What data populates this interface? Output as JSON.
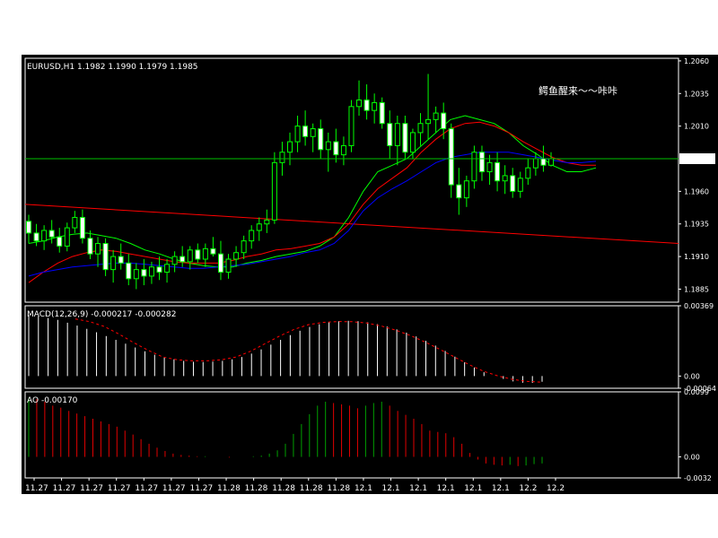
{
  "chart_data": [
    {
      "type": "candlestick",
      "title": "EURUSD,H1  1.1982 1.1990 1.1979 1.1985",
      "annotation": "鳄鱼醒来～～咔咔",
      "yticks": [
        "1.2060",
        "1.2035",
        "1.2010",
        "1.1960",
        "1.1935",
        "1.1910",
        "1.1885"
      ],
      "ylim": [
        1.1875,
        1.2062
      ],
      "current_price": 1.1985,
      "current_price_label": "1.1985",
      "x_tick_labels": [
        "11.27",
        "11.27",
        "11.27",
        "11.27",
        "11.27",
        "11.27",
        "11.27",
        "11.28",
        "11.28",
        "11.28",
        "11.28",
        "11.28",
        "12.1",
        "12.1",
        "12.1",
        "12.1",
        "12.1",
        "12.1",
        "12.2",
        "12.2"
      ],
      "candles": [
        {
          "o": 1.1937,
          "h": 1.1942,
          "l": 1.192,
          "c": 1.1928
        },
        {
          "o": 1.1928,
          "h": 1.1935,
          "l": 1.1918,
          "c": 1.1922
        },
        {
          "o": 1.1922,
          "h": 1.1934,
          "l": 1.1915,
          "c": 1.193
        },
        {
          "o": 1.193,
          "h": 1.1938,
          "l": 1.192,
          "c": 1.1925
        },
        {
          "o": 1.1925,
          "h": 1.1932,
          "l": 1.1913,
          "c": 1.1918
        },
        {
          "o": 1.1918,
          "h": 1.1936,
          "l": 1.1914,
          "c": 1.1932
        },
        {
          "o": 1.1932,
          "h": 1.1945,
          "l": 1.1928,
          "c": 1.194
        },
        {
          "o": 1.194,
          "h": 1.1946,
          "l": 1.192,
          "c": 1.1924
        },
        {
          "o": 1.1924,
          "h": 1.193,
          "l": 1.1908,
          "c": 1.1912
        },
        {
          "o": 1.1912,
          "h": 1.1925,
          "l": 1.1902,
          "c": 1.192
        },
        {
          "o": 1.192,
          "h": 1.1924,
          "l": 1.1895,
          "c": 1.19
        },
        {
          "o": 1.19,
          "h": 1.1915,
          "l": 1.189,
          "c": 1.191
        },
        {
          "o": 1.191,
          "h": 1.192,
          "l": 1.19,
          "c": 1.1905
        },
        {
          "o": 1.1905,
          "h": 1.1912,
          "l": 1.1888,
          "c": 1.1893
        },
        {
          "o": 1.1893,
          "h": 1.1905,
          "l": 1.1885,
          "c": 1.19
        },
        {
          "o": 1.19,
          "h": 1.1908,
          "l": 1.1888,
          "c": 1.1895
        },
        {
          "o": 1.1895,
          "h": 1.1906,
          "l": 1.1889,
          "c": 1.1902
        },
        {
          "o": 1.1902,
          "h": 1.191,
          "l": 1.1892,
          "c": 1.1898
        },
        {
          "o": 1.1898,
          "h": 1.1908,
          "l": 1.189,
          "c": 1.1904
        },
        {
          "o": 1.1904,
          "h": 1.1914,
          "l": 1.1898,
          "c": 1.191
        },
        {
          "o": 1.191,
          "h": 1.1918,
          "l": 1.1902,
          "c": 1.1906
        },
        {
          "o": 1.1906,
          "h": 1.1918,
          "l": 1.19,
          "c": 1.1915
        },
        {
          "o": 1.1915,
          "h": 1.192,
          "l": 1.1905,
          "c": 1.1908
        },
        {
          "o": 1.1908,
          "h": 1.192,
          "l": 1.1902,
          "c": 1.1916
        },
        {
          "o": 1.1916,
          "h": 1.1925,
          "l": 1.191,
          "c": 1.1912
        },
        {
          "o": 1.1912,
          "h": 1.1922,
          "l": 1.1892,
          "c": 1.1898
        },
        {
          "o": 1.1898,
          "h": 1.1912,
          "l": 1.1893,
          "c": 1.1908
        },
        {
          "o": 1.1908,
          "h": 1.1918,
          "l": 1.1902,
          "c": 1.1913
        },
        {
          "o": 1.1913,
          "h": 1.1926,
          "l": 1.1908,
          "c": 1.1922
        },
        {
          "o": 1.1922,
          "h": 1.1934,
          "l": 1.1916,
          "c": 1.193
        },
        {
          "o": 1.193,
          "h": 1.194,
          "l": 1.1922,
          "c": 1.1935
        },
        {
          "o": 1.1935,
          "h": 1.1946,
          "l": 1.1928,
          "c": 1.1938
        },
        {
          "o": 1.1938,
          "h": 1.199,
          "l": 1.1935,
          "c": 1.1982
        },
        {
          "o": 1.1982,
          "h": 1.1998,
          "l": 1.1972,
          "c": 1.199
        },
        {
          "o": 1.199,
          "h": 1.2005,
          "l": 1.198,
          "c": 1.1998
        },
        {
          "o": 1.1998,
          "h": 1.2018,
          "l": 1.199,
          "c": 1.201
        },
        {
          "o": 1.201,
          "h": 1.2022,
          "l": 1.1995,
          "c": 1.2002
        },
        {
          "o": 1.2002,
          "h": 1.2012,
          "l": 1.199,
          "c": 1.2008
        },
        {
          "o": 1.2008,
          "h": 1.2015,
          "l": 1.1985,
          "c": 1.1992
        },
        {
          "o": 1.1992,
          "h": 1.2005,
          "l": 1.1975,
          "c": 1.1998
        },
        {
          "o": 1.1998,
          "h": 1.2008,
          "l": 1.1982,
          "c": 1.1988
        },
        {
          "o": 1.1988,
          "h": 1.2002,
          "l": 1.198,
          "c": 1.1995
        },
        {
          "o": 1.1995,
          "h": 1.203,
          "l": 1.199,
          "c": 1.2025
        },
        {
          "o": 1.2025,
          "h": 1.2045,
          "l": 1.2018,
          "c": 1.203
        },
        {
          "o": 1.203,
          "h": 1.2042,
          "l": 1.2015,
          "c": 1.2022
        },
        {
          "o": 1.2022,
          "h": 1.2035,
          "l": 1.2012,
          "c": 1.2028
        },
        {
          "o": 1.2028,
          "h": 1.2032,
          "l": 1.2008,
          "c": 1.2012
        },
        {
          "o": 1.2012,
          "h": 1.2022,
          "l": 1.1985,
          "c": 1.1995
        },
        {
          "o": 1.1995,
          "h": 1.2018,
          "l": 1.198,
          "c": 1.2012
        },
        {
          "o": 1.2012,
          "h": 1.2018,
          "l": 1.1985,
          "c": 1.199
        },
        {
          "o": 1.199,
          "h": 1.2008,
          "l": 1.1985,
          "c": 1.2005
        },
        {
          "o": 1.2005,
          "h": 1.202,
          "l": 1.1995,
          "c": 1.2012
        },
        {
          "o": 1.2012,
          "h": 1.205,
          "l": 1.2,
          "c": 1.2015
        },
        {
          "o": 1.2015,
          "h": 1.2025,
          "l": 1.2005,
          "c": 1.202
        },
        {
          "o": 1.202,
          "h": 1.2028,
          "l": 1.2,
          "c": 1.2008
        },
        {
          "o": 1.2008,
          "h": 1.2012,
          "l": 1.1955,
          "c": 1.1965
        },
        {
          "o": 1.1965,
          "h": 1.1978,
          "l": 1.1942,
          "c": 1.1955
        },
        {
          "o": 1.1955,
          "h": 1.1972,
          "l": 1.1948,
          "c": 1.1968
        },
        {
          "o": 1.1968,
          "h": 1.1995,
          "l": 1.1962,
          "c": 1.199
        },
        {
          "o": 1.199,
          "h": 1.1995,
          "l": 1.1968,
          "c": 1.1975
        },
        {
          "o": 1.1975,
          "h": 1.1988,
          "l": 1.1965,
          "c": 1.1982
        },
        {
          "o": 1.1982,
          "h": 1.199,
          "l": 1.196,
          "c": 1.1968
        },
        {
          "o": 1.1968,
          "h": 1.198,
          "l": 1.1958,
          "c": 1.1972
        },
        {
          "o": 1.1972,
          "h": 1.1978,
          "l": 1.1955,
          "c": 1.196
        },
        {
          "o": 1.196,
          "h": 1.1975,
          "l": 1.1955,
          "c": 1.197
        },
        {
          "o": 1.197,
          "h": 1.1985,
          "l": 1.1965,
          "c": 1.1978
        },
        {
          "o": 1.1978,
          "h": 1.199,
          "l": 1.1972,
          "c": 1.1985
        },
        {
          "o": 1.1985,
          "h": 1.1995,
          "l": 1.1975,
          "c": 1.198
        },
        {
          "o": 1.198,
          "h": 1.199,
          "l": 1.1979,
          "c": 1.1985
        }
      ],
      "moving_averages": [
        {
          "color": "#00ff00",
          "points": [
            1.192,
            1.1922,
            1.1925,
            1.1927,
            1.1928,
            1.1926,
            1.1924,
            1.192,
            1.1915,
            1.1912,
            1.1908,
            1.1905,
            1.1903,
            1.1902,
            1.1902,
            1.1905,
            1.1907,
            1.191,
            1.1912,
            1.1914,
            1.1918,
            1.1925,
            1.194,
            1.196,
            1.1975,
            1.198,
            1.1985,
            1.1995,
            1.2005,
            1.2015,
            1.2018,
            1.2015,
            1.2012,
            1.2005,
            1.1995,
            1.1988,
            1.198,
            1.1975,
            1.1975,
            1.1978
          ]
        },
        {
          "color": "#ff0000",
          "points": [
            1.189,
            1.1898,
            1.1905,
            1.191,
            1.1913,
            1.1915,
            1.1914,
            1.1912,
            1.191,
            1.1908,
            1.1906,
            1.1905,
            1.1905,
            1.1905,
            1.1907,
            1.191,
            1.1912,
            1.1915,
            1.1916,
            1.1918,
            1.192,
            1.1925,
            1.1935,
            1.195,
            1.1962,
            1.197,
            1.1978,
            1.199,
            1.2,
            1.2008,
            1.2012,
            1.2013,
            1.201,
            1.2005,
            1.1998,
            1.1992,
            1.1986,
            1.1982,
            1.198,
            1.198
          ]
        },
        {
          "color": "#0000ff",
          "points": [
            1.1895,
            1.1898,
            1.19,
            1.1902,
            1.1903,
            1.1904,
            1.1905,
            1.1905,
            1.1904,
            1.1903,
            1.1902,
            1.1901,
            1.1901,
            1.1902,
            1.1903,
            1.1904,
            1.1906,
            1.1908,
            1.191,
            1.1913,
            1.1915,
            1.192,
            1.193,
            1.1945,
            1.1955,
            1.1962,
            1.1968,
            1.1975,
            1.1982,
            1.1986,
            1.1988,
            1.199,
            1.199,
            1.199,
            1.1988,
            1.1986,
            1.1984,
            1.1982,
            1.1982,
            1.1983
          ]
        }
      ],
      "trend_line": {
        "color": "#ff0000",
        "from": 1.195,
        "to": 1.192
      }
    },
    {
      "type": "bar",
      "title": "MACD(12,26,9)  -0.000217  -0.000282",
      "yticks": [
        "0.00369",
        "0.00",
        "-0.00064"
      ],
      "ylim": [
        -0.00064,
        0.00369
      ],
      "histogram": [
        0.0032,
        0.00315,
        0.00305,
        0.00295,
        0.0028,
        0.00265,
        0.00248,
        0.0023,
        0.0021,
        0.0019,
        0.0017,
        0.0015,
        0.0013,
        0.00112,
        0.00098,
        0.00088,
        0.0008,
        0.00075,
        0.00074,
        0.00076,
        0.0008,
        0.00088,
        0.001,
        0.00118,
        0.0014,
        0.00165,
        0.0019,
        0.00215,
        0.00238,
        0.00258,
        0.00272,
        0.00282,
        0.00288,
        0.0029,
        0.00288,
        0.00282,
        0.00272,
        0.0026,
        0.00245,
        0.00228,
        0.00208,
        0.00185,
        0.0016,
        0.00132,
        0.00102,
        0.00072,
        0.00045,
        0.0002,
        0.0,
        -0.00015,
        -0.00028,
        -0.00035,
        -0.00036,
        -0.0003
      ],
      "signal_color": "#ff0000",
      "signal": [
        0.003,
        0.00285,
        0.0026,
        0.0022,
        0.00175,
        0.00135,
        0.001,
        0.00085,
        0.0008,
        0.0008,
        0.00085,
        0.001,
        0.0013,
        0.0017,
        0.0021,
        0.00245,
        0.0027,
        0.00282,
        0.00286,
        0.00285,
        0.00278,
        0.00262,
        0.0024,
        0.00212,
        0.00178,
        0.0014,
        0.001,
        0.0006,
        0.00025,
        0.0,
        -0.00018,
        -0.00028,
        -0.00032
      ]
    },
    {
      "type": "bar",
      "title": "AO  -0.00170",
      "yticks": [
        "0.0099",
        "0.00",
        "-0.0032"
      ],
      "ylim": [
        -0.0032,
        0.0099
      ],
      "values": [
        0.009,
        0.0088,
        0.0084,
        0.0078,
        0.0075,
        0.007,
        0.0066,
        0.0062,
        0.0058,
        0.0054,
        0.005,
        0.0046,
        0.004,
        0.0034,
        0.0027,
        0.002,
        0.0014,
        0.0009,
        0.0005,
        0.0003,
        0.0002,
        0.0001,
        0.0001,
        0.0,
        0.0,
        -0.0001,
        0.0,
        0.0,
        0.0001,
        0.0002,
        0.0005,
        0.001,
        0.002,
        0.0035,
        0.005,
        0.0065,
        0.0078,
        0.0084,
        0.0082,
        0.008,
        0.0078,
        0.0074,
        0.0078,
        0.0082,
        0.0084,
        0.0078,
        0.007,
        0.0064,
        0.0058,
        0.005,
        0.004,
        0.0038,
        0.0036,
        0.003,
        0.002,
        0.0006,
        -0.0004,
        -0.001,
        -0.0012,
        -0.0013,
        -0.0012,
        -0.0014,
        -0.0013,
        -0.0011,
        -0.001
      ]
    }
  ]
}
